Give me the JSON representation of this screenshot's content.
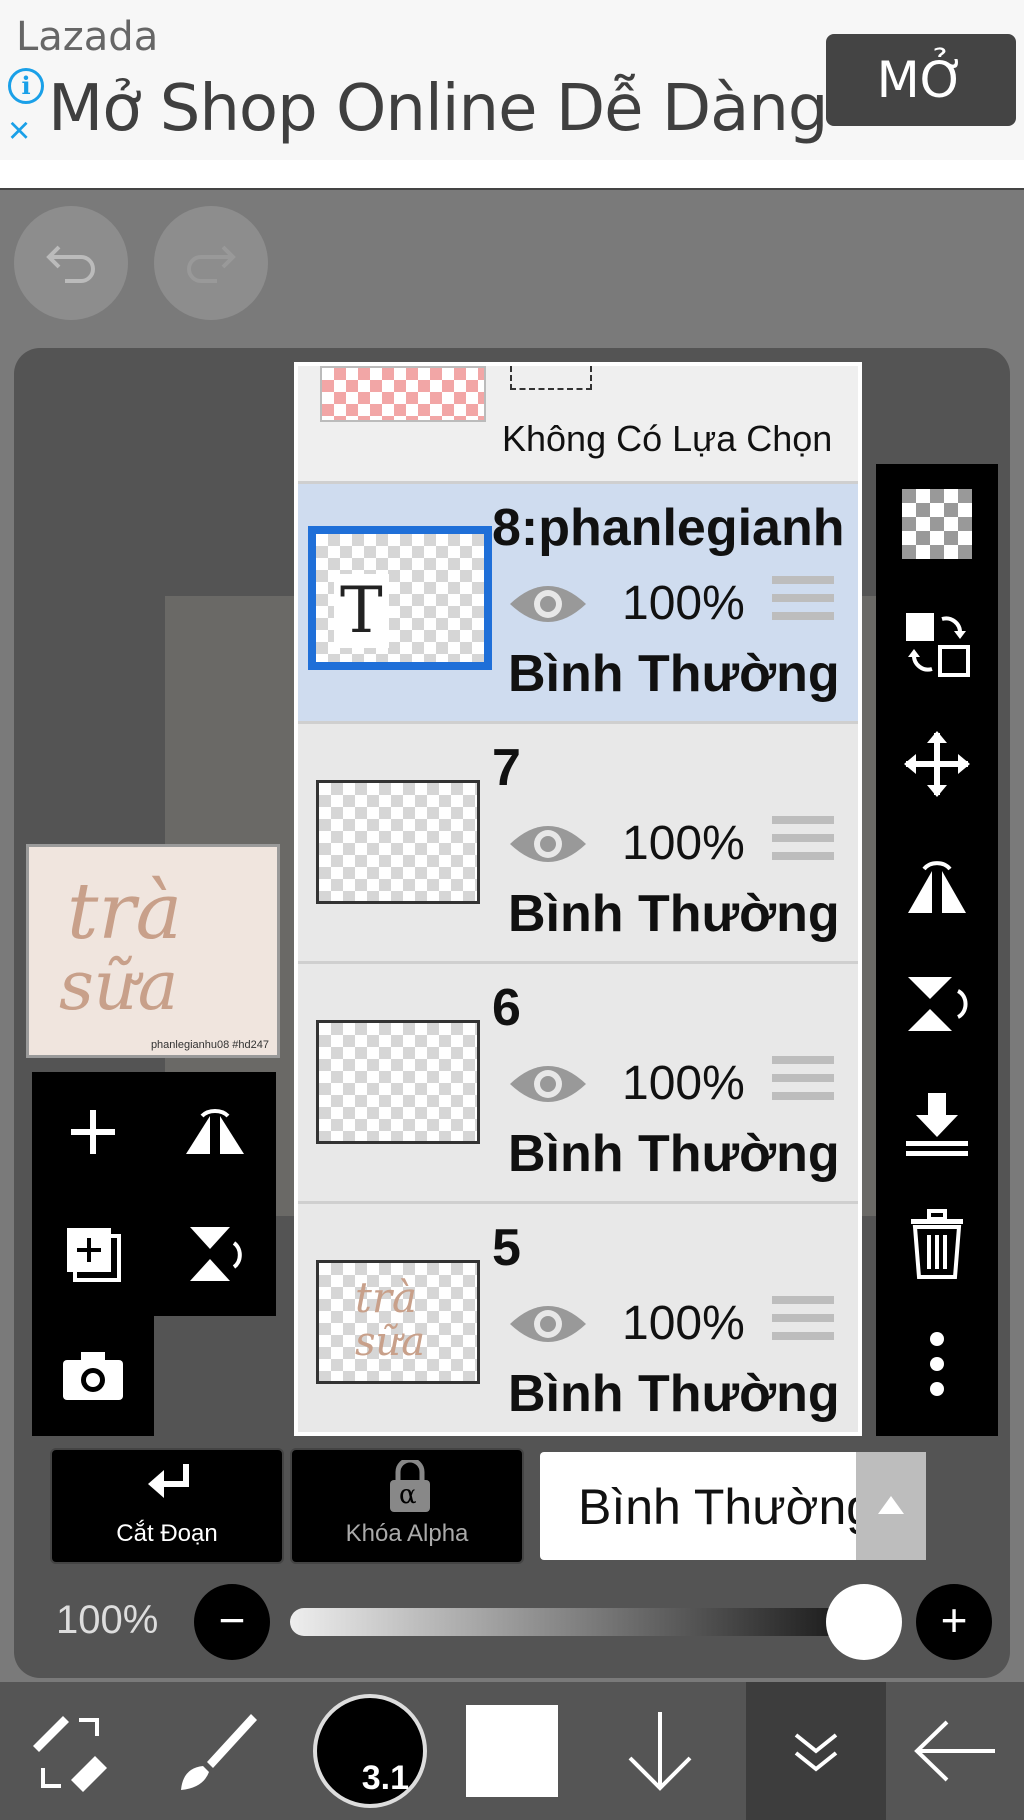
{
  "ad": {
    "brand": "Lazada",
    "headline": "Mở Shop Online Dễ Dàng",
    "cta": "MỞ",
    "info_icon": "info-icon",
    "close_icon": "close-icon"
  },
  "thumbnail": {
    "word1": "trà",
    "word2": "sữa",
    "credit": "phanlegianhu08 #hd247"
  },
  "layers": {
    "top_selection_label": "Không Có Lựa Chọn",
    "items": [
      {
        "name": "8:phanlegianh",
        "opacity": "100%",
        "mode": "Bình Thường",
        "active": true,
        "thumb": "T"
      },
      {
        "name": "7",
        "opacity": "100%",
        "mode": "Bình Thường",
        "active": false
      },
      {
        "name": "6",
        "opacity": "100%",
        "mode": "Bình Thường",
        "active": false
      },
      {
        "name": "5",
        "opacity": "100%",
        "mode": "Bình Thường",
        "active": false,
        "thumb_word1": "trà",
        "thumb_word2": "sữa"
      }
    ]
  },
  "bottom_controls": {
    "cut_label": "Cắt Đoạn",
    "alpha_label": "Khóa Alpha",
    "alpha_symbol": "α",
    "blend_mode": "Bình Thường"
  },
  "opacity": {
    "label": "100%",
    "value": 1.0
  },
  "toolbar": {
    "brush_size": "3.1",
    "color": "#ffffff"
  },
  "colors": {
    "panel": "#545454",
    "active_layer": "#cfdcef",
    "selection_border": "#1f6fd8",
    "ad_accent": "#1aa0e8"
  }
}
